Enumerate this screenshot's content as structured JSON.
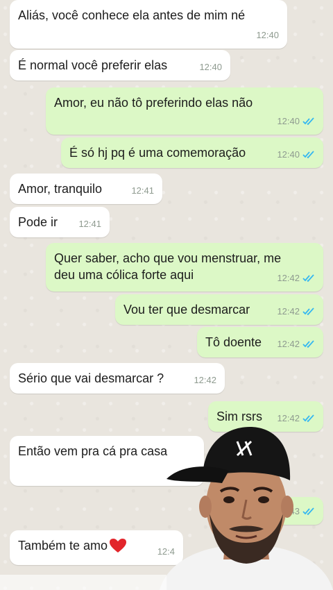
{
  "messages": [
    {
      "text": "Aliás, você conhece ela antes de mim né",
      "time": "12:40"
    },
    {
      "text": "É normal você preferir elas",
      "time": "12:40"
    },
    {
      "text": "Amor, eu não tô preferindo elas não",
      "time": "12:40"
    },
    {
      "text": "É só hj pq é uma comemoração",
      "time": "12:40"
    },
    {
      "text": "Amor, tranquilo",
      "time": "12:41"
    },
    {
      "text": "Pode ir",
      "time": "12:41"
    },
    {
      "text": "Quer saber, acho que vou menstruar, me deu uma cólica forte aqui",
      "line1": "Quer saber, acho que vou menstruar, me",
      "line2": "deu uma cólica forte aqui",
      "time": "12:42"
    },
    {
      "text": "Vou ter que desmarcar",
      "time": "12:42"
    },
    {
      "text": "Tô doente",
      "time": "12:42"
    },
    {
      "text": "Sério que vai desmarcar ?",
      "time": "12:42"
    },
    {
      "text": "Sim rsrs",
      "time": "12:42"
    },
    {
      "text": "Então vem pra cá pra casa",
      "time": ""
    },
    {
      "text": "",
      "time": "43"
    },
    {
      "text": "Também te amo",
      "time": "12:4"
    }
  ],
  "colors": {
    "incoming": "#ffffff",
    "outgoing": "#dcf8c6",
    "read_check": "#34b7f1"
  }
}
